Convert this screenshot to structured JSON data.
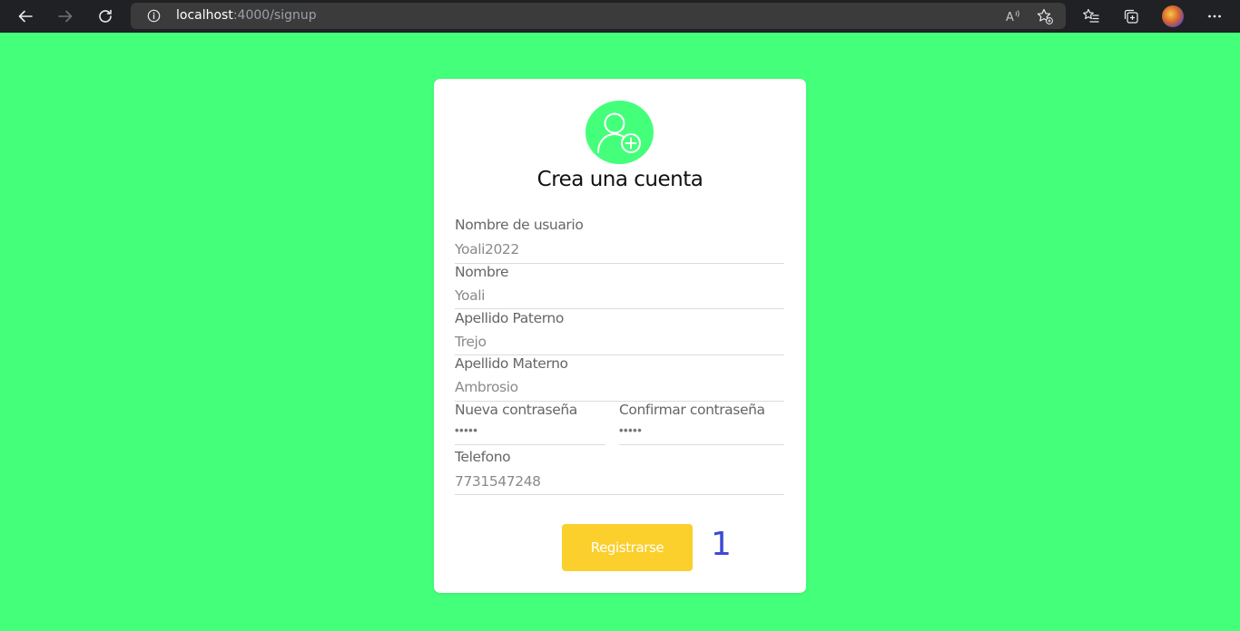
{
  "browser": {
    "url_host": "localhost",
    "url_path": ":4000/signup"
  },
  "form": {
    "title": "Crea una cuenta",
    "fields": {
      "username": {
        "label": "Nombre de usuario",
        "value": "Yoali2022"
      },
      "nombre": {
        "label": "Nombre",
        "value": "Yoali"
      },
      "apellido_paterno": {
        "label": "Apellido Paterno",
        "value": "Trejo"
      },
      "apellido_materno": {
        "label": "Apellido Materno",
        "value": "Ambrosio"
      },
      "nueva_contrasena": {
        "label": "Nueva contraseña",
        "value": "•••••"
      },
      "confirmar_contrasena": {
        "label": "Confirmar contraseña",
        "value": "•••••"
      },
      "telefono": {
        "label": "Telefono",
        "value": "7731547248"
      }
    },
    "submit_label": "Registrarse",
    "counter": "1"
  },
  "icons": {
    "back": "back-arrow-icon",
    "forward": "forward-arrow-icon",
    "reload": "reload-icon",
    "info": "info-icon",
    "read_aloud": "read-aloud-icon",
    "add_favorite": "add-favorite-icon",
    "favorites": "favorites-icon",
    "collections": "collections-icon",
    "profile": "profile-avatar",
    "menu": "more-menu-icon",
    "logo": "add-user-icon"
  },
  "colors": {
    "page_background": "#44ff7a",
    "submit_button": "#fbcf2c",
    "counter": "#3a4bd4"
  }
}
